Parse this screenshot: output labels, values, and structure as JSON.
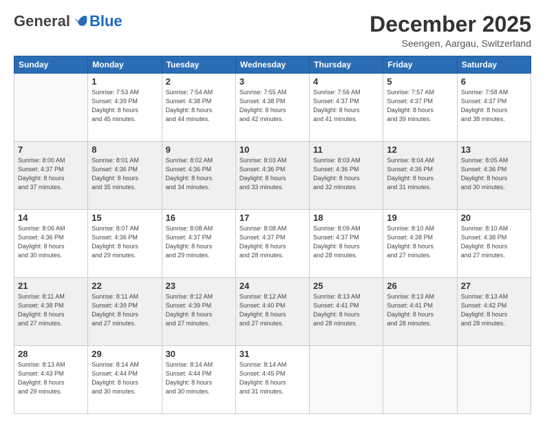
{
  "logo": {
    "general": "General",
    "blue": "Blue"
  },
  "header": {
    "month": "December 2025",
    "location": "Seengen, Aargau, Switzerland"
  },
  "weekdays": [
    "Sunday",
    "Monday",
    "Tuesday",
    "Wednesday",
    "Thursday",
    "Friday",
    "Saturday"
  ],
  "weeks": [
    [
      {
        "day": "",
        "info": ""
      },
      {
        "day": "1",
        "info": "Sunrise: 7:53 AM\nSunset: 4:39 PM\nDaylight: 8 hours\nand 45 minutes."
      },
      {
        "day": "2",
        "info": "Sunrise: 7:54 AM\nSunset: 4:38 PM\nDaylight: 8 hours\nand 44 minutes."
      },
      {
        "day": "3",
        "info": "Sunrise: 7:55 AM\nSunset: 4:38 PM\nDaylight: 8 hours\nand 42 minutes."
      },
      {
        "day": "4",
        "info": "Sunrise: 7:56 AM\nSunset: 4:37 PM\nDaylight: 8 hours\nand 41 minutes."
      },
      {
        "day": "5",
        "info": "Sunrise: 7:57 AM\nSunset: 4:37 PM\nDaylight: 8 hours\nand 39 minutes."
      },
      {
        "day": "6",
        "info": "Sunrise: 7:58 AM\nSunset: 4:37 PM\nDaylight: 8 hours\nand 38 minutes."
      }
    ],
    [
      {
        "day": "7",
        "info": ""
      },
      {
        "day": "8",
        "info": "Sunrise: 8:01 AM\nSunset: 4:36 PM\nDaylight: 8 hours\nand 35 minutes."
      },
      {
        "day": "9",
        "info": "Sunrise: 8:02 AM\nSunset: 4:36 PM\nDaylight: 8 hours\nand 34 minutes."
      },
      {
        "day": "10",
        "info": "Sunrise: 8:03 AM\nSunset: 4:36 PM\nDaylight: 8 hours\nand 33 minutes."
      },
      {
        "day": "11",
        "info": "Sunrise: 8:03 AM\nSunset: 4:36 PM\nDaylight: 8 hours\nand 32 minutes."
      },
      {
        "day": "12",
        "info": "Sunrise: 8:04 AM\nSunset: 4:36 PM\nDaylight: 8 hours\nand 31 minutes."
      },
      {
        "day": "13",
        "info": "Sunrise: 8:05 AM\nSunset: 4:36 PM\nDaylight: 8 hours\nand 30 minutes."
      }
    ],
    [
      {
        "day": "14",
        "info": ""
      },
      {
        "day": "15",
        "info": "Sunrise: 8:07 AM\nSunset: 4:36 PM\nDaylight: 8 hours\nand 29 minutes."
      },
      {
        "day": "16",
        "info": "Sunrise: 8:08 AM\nSunset: 4:37 PM\nDaylight: 8 hours\nand 29 minutes."
      },
      {
        "day": "17",
        "info": "Sunrise: 8:08 AM\nSunset: 4:37 PM\nDaylight: 8 hours\nand 28 minutes."
      },
      {
        "day": "18",
        "info": "Sunrise: 8:09 AM\nSunset: 4:37 PM\nDaylight: 8 hours\nand 28 minutes."
      },
      {
        "day": "19",
        "info": "Sunrise: 8:10 AM\nSunset: 4:38 PM\nDaylight: 8 hours\nand 27 minutes."
      },
      {
        "day": "20",
        "info": "Sunrise: 8:10 AM\nSunset: 4:38 PM\nDaylight: 8 hours\nand 27 minutes."
      }
    ],
    [
      {
        "day": "21",
        "info": ""
      },
      {
        "day": "22",
        "info": "Sunrise: 8:11 AM\nSunset: 4:39 PM\nDaylight: 8 hours\nand 27 minutes."
      },
      {
        "day": "23",
        "info": "Sunrise: 8:12 AM\nSunset: 4:39 PM\nDaylight: 8 hours\nand 27 minutes."
      },
      {
        "day": "24",
        "info": "Sunrise: 8:12 AM\nSunset: 4:40 PM\nDaylight: 8 hours\nand 27 minutes."
      },
      {
        "day": "25",
        "info": "Sunrise: 8:13 AM\nSunset: 4:41 PM\nDaylight: 8 hours\nand 28 minutes."
      },
      {
        "day": "26",
        "info": "Sunrise: 8:13 AM\nSunset: 4:41 PM\nDaylight: 8 hours\nand 28 minutes."
      },
      {
        "day": "27",
        "info": "Sunrise: 8:13 AM\nSunset: 4:42 PM\nDaylight: 8 hours\nand 28 minutes."
      }
    ],
    [
      {
        "day": "28",
        "info": "Sunrise: 8:13 AM\nSunset: 4:43 PM\nDaylight: 8 hours\nand 29 minutes."
      },
      {
        "day": "29",
        "info": "Sunrise: 8:14 AM\nSunset: 4:44 PM\nDaylight: 8 hours\nand 30 minutes."
      },
      {
        "day": "30",
        "info": "Sunrise: 8:14 AM\nSunset: 4:44 PM\nDaylight: 8 hours\nand 30 minutes."
      },
      {
        "day": "31",
        "info": "Sunrise: 8:14 AM\nSunset: 4:45 PM\nDaylight: 8 hours\nand 31 minutes."
      },
      {
        "day": "",
        "info": ""
      },
      {
        "day": "",
        "info": ""
      },
      {
        "day": "",
        "info": ""
      }
    ]
  ],
  "week7_sun": {
    "day": "7",
    "info": "Sunrise: 8:00 AM\nSunset: 4:37 PM\nDaylight: 8 hours\nand 37 minutes."
  },
  "week14_sun": {
    "day": "14",
    "info": "Sunrise: 8:06 AM\nSunset: 4:36 PM\nDaylight: 8 hours\nand 30 minutes."
  },
  "week21_sun": {
    "day": "21",
    "info": "Sunrise: 8:11 AM\nSunset: 4:38 PM\nDaylight: 8 hours\nand 27 minutes."
  }
}
